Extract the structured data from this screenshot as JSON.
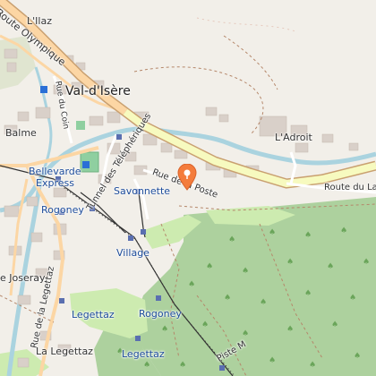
{
  "map": {
    "labels": {
      "route_olympique": "Route Olympique",
      "lilaz": "L'Ilaz",
      "val_disere": "Val-d'Isère",
      "rue_coin": "Rue du Coin",
      "rue_tt": "Tunnel des Téléphériques",
      "ladroit": "L'Adroit",
      "balme": "Balme",
      "bellevarde": "Bellevarde",
      "express": "Express",
      "rogoney1": "Rogoney",
      "savonnette": "Savonnette",
      "rue_de_la_poste": "Rue de la Poste",
      "route_laisinant": "Route du Laisinant",
      "village": "Village",
      "joseray": "e Joseray",
      "rue_legettaz": "Rue de la Legettaz",
      "legettaz1": "Legettaz",
      "rogoney2": "Rogoney",
      "legettaz2": "Legettaz",
      "la_legettaz": "La Legettaz",
      "piste_m": "Piste M"
    },
    "icons": {
      "pin": "map-marker-icon",
      "station": "lift-station-icon",
      "tree": "tree-icon",
      "parking": "parking-icon"
    },
    "colors": {
      "background": "#f2efe9",
      "road_main": "#f7fabf",
      "road_main_casing": "#c9c97a",
      "road_orange": "#fcd6a4",
      "river": "#aad3df",
      "forest": "#add19e",
      "meadow": "#cdebb0",
      "building": "#d9d0c9",
      "lift": "#333333",
      "station": "#5a6fb0",
      "pin": "#f47c3c"
    }
  }
}
